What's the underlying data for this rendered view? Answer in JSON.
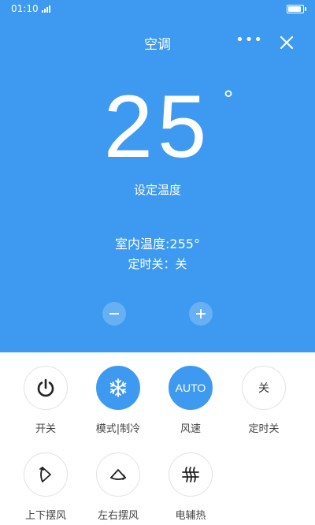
{
  "status_bar": {
    "time": "01:10"
  },
  "header": {
    "title": "空调",
    "more_label": "•••"
  },
  "display": {
    "set_temperature": "25",
    "degree_symbol": "°",
    "set_temperature_label": "设定温度",
    "indoor_temperature": "室内温度:255°",
    "timer_status": "定时关：关"
  },
  "controls": {
    "minus": "minus-icon",
    "plus": "plus-icon",
    "items": [
      {
        "label": "开关",
        "icon": "power-icon"
      },
      {
        "label": "模式|制冷",
        "icon": "snowflake-icon",
        "active": true
      },
      {
        "label": "风速",
        "icon_text": "AUTO",
        "active": true
      },
      {
        "label": "定时关",
        "icon_text": "关"
      },
      {
        "label": "上下摆风",
        "icon": "vertical-swing-icon"
      },
      {
        "label": "左右摆风",
        "icon": "horizontal-swing-icon"
      },
      {
        "label": "电辅热",
        "icon": "heater-icon"
      }
    ]
  },
  "colors": {
    "accent": "#3d9af0",
    "background": "#ffffff",
    "text": "#444444"
  }
}
